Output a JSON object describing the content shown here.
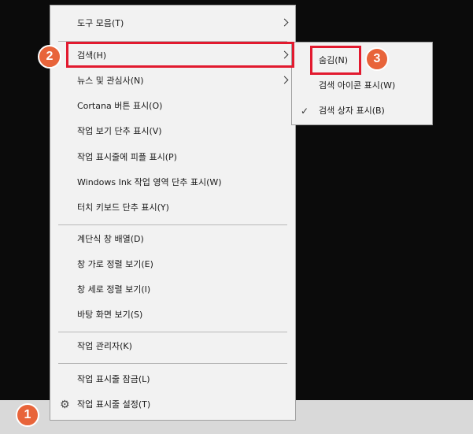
{
  "menu": {
    "items": [
      {
        "label": "도구 모음(T)"
      },
      {
        "label": "검색(H)"
      },
      {
        "label": "뉴스 및 관심사(N)"
      },
      {
        "label": "Cortana 버튼 표시(O)"
      },
      {
        "label": "작업 보기 단추 표시(V)"
      },
      {
        "label": "작업 표시줄에 피플 표시(P)"
      },
      {
        "label": "Windows Ink 작업 영역 단추 표시(W)"
      },
      {
        "label": "터치 키보드 단추 표시(Y)"
      },
      {
        "label": "계단식 창 배열(D)"
      },
      {
        "label": "창 가로 정렬 보기(E)"
      },
      {
        "label": "창 세로 정렬 보기(I)"
      },
      {
        "label": "바탕 화면 보기(S)"
      },
      {
        "label": "작업 관리자(K)"
      },
      {
        "label": "작업 표시줄 잠금(L)"
      },
      {
        "label": "작업 표시줄 설정(T)"
      }
    ]
  },
  "submenu": {
    "items": [
      {
        "label": "숨김(N)",
        "checked": false
      },
      {
        "label": "검색 아이콘 표시(W)",
        "checked": false
      },
      {
        "label": "검색 상자 표시(B)",
        "checked": true
      }
    ],
    "check_mark": "✓"
  },
  "icons": {
    "gear": "⚙"
  },
  "badges": {
    "one": "1",
    "two": "2",
    "three": "3"
  },
  "colors": {
    "highlight": "#e21a2f",
    "badge": "#e8643a"
  }
}
